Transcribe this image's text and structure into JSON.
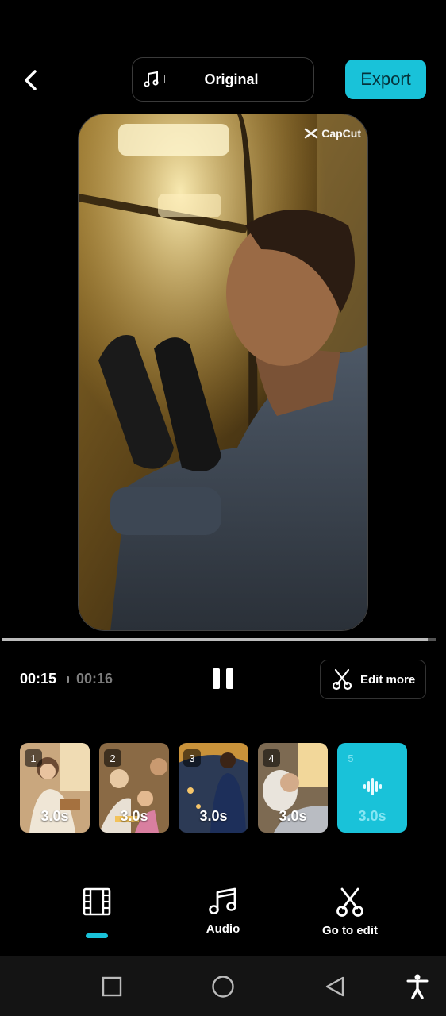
{
  "header": {
    "sound_label": "Original",
    "export_label": "Export"
  },
  "preview": {
    "watermark": "CapCut"
  },
  "playback": {
    "current_time": "00:15",
    "total_time": "00:16",
    "progress": 0.98,
    "edit_more_label": "Edit more"
  },
  "clips": [
    {
      "index": "1",
      "duration": "3.0s"
    },
    {
      "index": "2",
      "duration": "3.0s"
    },
    {
      "index": "3",
      "duration": "3.0s"
    },
    {
      "index": "4",
      "duration": "3.0s"
    },
    {
      "index": "5",
      "duration": "3.0s"
    }
  ],
  "tabs": {
    "clips_label": "",
    "audio_label": "Audio",
    "edit_label": "Go to edit"
  },
  "colors": {
    "accent": "#19c2d9",
    "background": "#000000"
  },
  "icons": [
    "back-icon",
    "music-note-icon",
    "scissors-icon",
    "film-strip-icon",
    "square-icon",
    "circle-icon",
    "triangle-back-icon",
    "accessibility-icon",
    "audio-wave-icon"
  ]
}
